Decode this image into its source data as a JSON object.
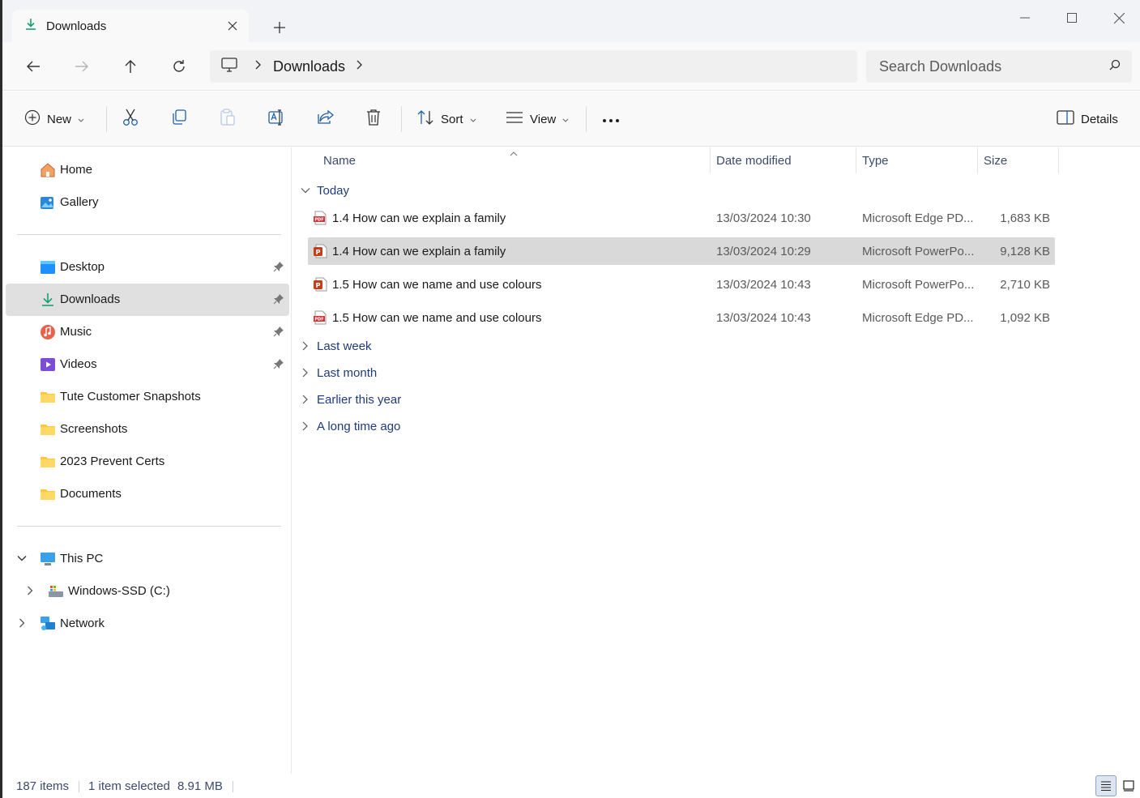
{
  "tab": {
    "title": "Downloads",
    "icon": "download-icon"
  },
  "address": {
    "crumbs": [
      "Downloads"
    ],
    "search_placeholder": "Search Downloads"
  },
  "commandbar": {
    "new_label": "New",
    "sort_label": "Sort",
    "view_label": "View",
    "details_label": "Details"
  },
  "sidebar": {
    "quick": [
      {
        "label": "Home",
        "icon": "home-icon"
      },
      {
        "label": "Gallery",
        "icon": "gallery-icon"
      }
    ],
    "pinned": [
      {
        "label": "Desktop",
        "icon": "desktop-icon",
        "pinned": true
      },
      {
        "label": "Downloads",
        "icon": "download-icon",
        "pinned": true,
        "selected": true
      },
      {
        "label": "Music",
        "icon": "music-icon",
        "pinned": true
      },
      {
        "label": "Videos",
        "icon": "videos-icon",
        "pinned": true
      },
      {
        "label": "Tute Customer Snapshots",
        "icon": "folder-icon"
      },
      {
        "label": "Screenshots",
        "icon": "folder-icon"
      },
      {
        "label": "2023 Prevent Certs",
        "icon": "folder-icon"
      },
      {
        "label": "Documents",
        "icon": "folder-icon"
      }
    ],
    "tree": [
      {
        "label": "This PC",
        "icon": "pc-icon",
        "expanded": true
      },
      {
        "label": "Windows-SSD (C:)",
        "icon": "drive-icon",
        "expanded": false
      },
      {
        "label": "Network",
        "icon": "network-icon",
        "expanded": false
      }
    ]
  },
  "columns": {
    "name": "Name",
    "date": "Date modified",
    "type": "Type",
    "size": "Size"
  },
  "groups": {
    "today": "Today",
    "collapsed": [
      "Last week",
      "Last month",
      "Earlier this year",
      "A long time ago"
    ]
  },
  "files": [
    {
      "name": "1.4 How can we explain a family",
      "date": "13/03/2024 10:30",
      "type": "Microsoft Edge PD...",
      "size": "1,683 KB",
      "icon": "pdf-icon"
    },
    {
      "name": "1.4 How can we explain a family",
      "date": "13/03/2024 10:29",
      "type": "Microsoft PowerPo...",
      "size": "9,128 KB",
      "icon": "powerpoint-icon",
      "selected": true
    },
    {
      "name": "1.5 How can we name and use colours",
      "date": "13/03/2024 10:43",
      "type": "Microsoft PowerPo...",
      "size": "2,710 KB",
      "icon": "powerpoint-icon"
    },
    {
      "name": "1.5 How can we name and use colours",
      "date": "13/03/2024 10:43",
      "type": "Microsoft Edge PD...",
      "size": "1,092 KB",
      "icon": "pdf-icon"
    }
  ],
  "status": {
    "items": "187 items",
    "selected": "1 item selected",
    "size": "8.91 MB"
  },
  "colors": {
    "accent": "#0067c0",
    "group_text": "#1f3b7a",
    "selected_row": "#d9d9d9"
  }
}
